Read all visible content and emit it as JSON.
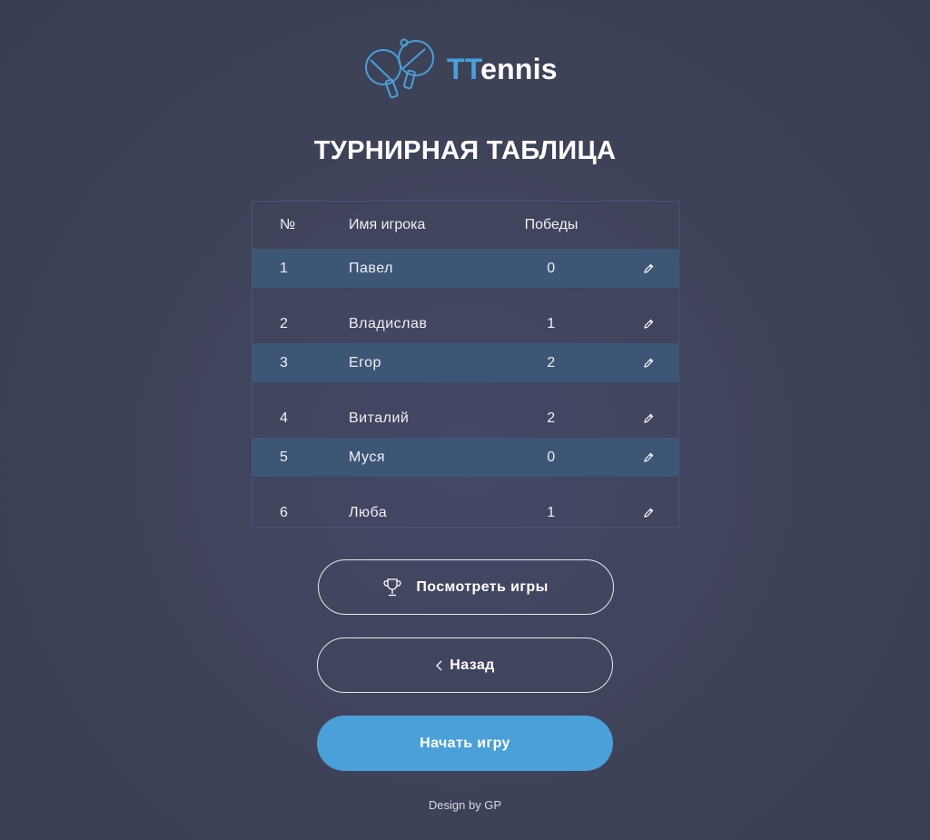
{
  "brand": {
    "logo_prefix": "TT",
    "logo_suffix": "ennis",
    "accent_color": "#4aa0d8"
  },
  "page_title": "ТУРНИРНАЯ ТАБЛИЦА",
  "table": {
    "columns": [
      "№",
      "Имя игрока",
      "Победы"
    ],
    "rows": [
      {
        "num": "1",
        "name": "Павел",
        "wins": "0"
      },
      {
        "num": "2",
        "name": "Владислав",
        "wins": "1"
      },
      {
        "num": "3",
        "name": "Егор",
        "wins": "2"
      },
      {
        "num": "4",
        "name": "Виталий",
        "wins": "2"
      },
      {
        "num": "5",
        "name": "Муся",
        "wins": "0"
      },
      {
        "num": "6",
        "name": "Люба",
        "wins": "1"
      }
    ],
    "row_action_icon": "pencil-icon"
  },
  "actions": {
    "view_games_label": "Посмотреть игры",
    "view_games_icon": "trophy-icon",
    "back_label": "Назад",
    "back_icon": "chevron-left-icon",
    "start_label": "Начать игру"
  },
  "footer": "Design by GP"
}
